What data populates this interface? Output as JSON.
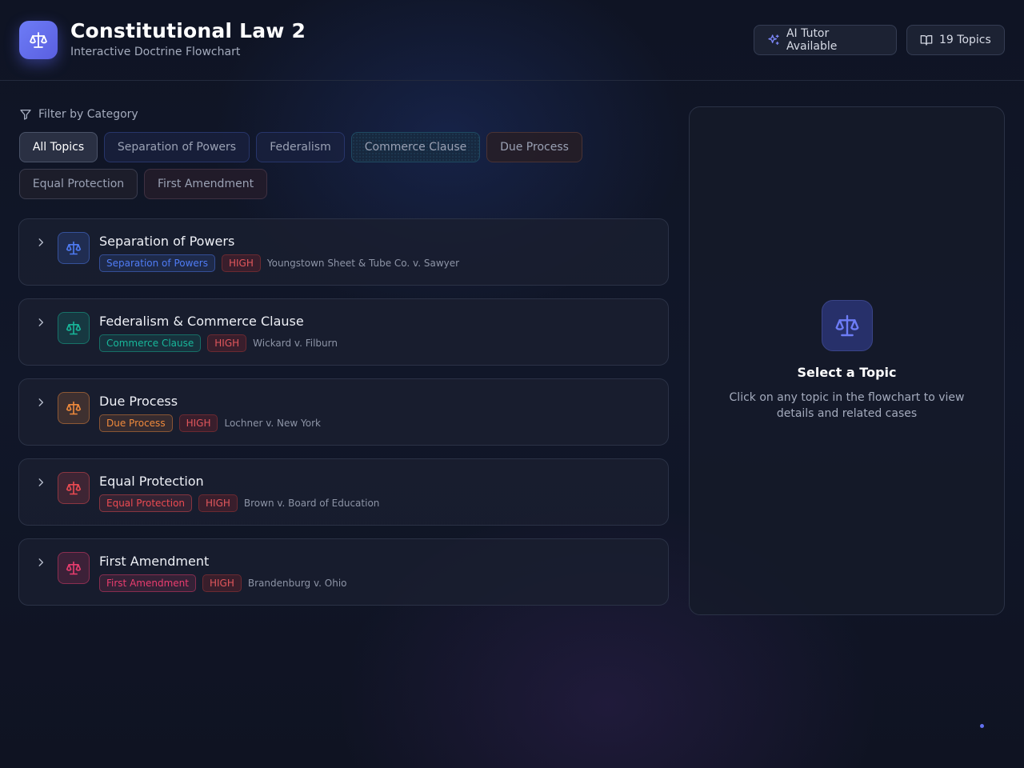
{
  "header": {
    "title": "Constitutional Law 2",
    "subtitle": "Interactive Doctrine Flowchart",
    "ai_tutor_label": "AI Tutor Available",
    "topics_count_label": "19 Topics"
  },
  "filter": {
    "label": "Filter by Category",
    "chips": [
      {
        "label": "All Topics",
        "active": true
      },
      {
        "label": "Separation of Powers"
      },
      {
        "label": "Federalism"
      },
      {
        "label": "Commerce Clause"
      },
      {
        "label": "Due Process"
      },
      {
        "label": "Equal Protection"
      },
      {
        "label": "First Amendment"
      }
    ]
  },
  "topics": [
    {
      "title": "Separation of Powers",
      "category": "Separation of Powers",
      "importance": "HIGH",
      "case": "Youngstown Sheet & Tube Co. v. Sawyer",
      "color": "#4f7cf5"
    },
    {
      "title": "Federalism & Commerce Clause",
      "category": "Commerce Clause",
      "importance": "HIGH",
      "case": "Wickard v. Filburn",
      "color": "#18b79a"
    },
    {
      "title": "Due Process",
      "category": "Due Process",
      "importance": "HIGH",
      "case": "Lochner v. New York",
      "color": "#f08a3c"
    },
    {
      "title": "Equal Protection",
      "category": "Equal Protection",
      "importance": "HIGH",
      "case": "Brown v. Board of Education",
      "color": "#ec4b52"
    },
    {
      "title": "First Amendment",
      "category": "First Amendment",
      "importance": "HIGH",
      "case": "Brandenburg v. Ohio",
      "color": "#ea3d6f"
    }
  ],
  "details_panel": {
    "title": "Select a Topic",
    "description": "Click on any topic in the flowchart to view details and related cases"
  },
  "colors": {
    "accent": "#6270f0",
    "high_badge": "#e2575c"
  },
  "icons": {
    "logo": "scale-icon",
    "ai_tutor": "sparkles-icon",
    "topics": "book-icon",
    "filter": "filter-icon",
    "expand": "chevron-right-icon"
  }
}
